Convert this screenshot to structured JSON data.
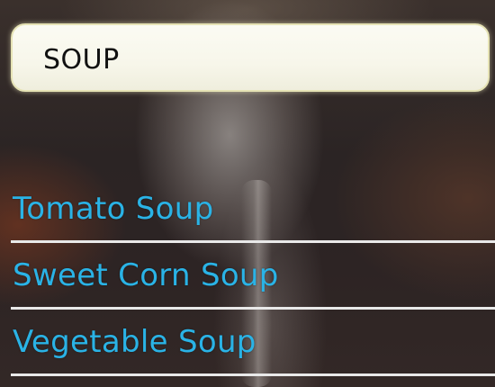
{
  "search": {
    "value": "SOUP",
    "placeholder": ""
  },
  "results": [
    {
      "label": "Tomato Soup"
    },
    {
      "label": "Sweet Corn Soup"
    },
    {
      "label": "Vegetable Soup"
    }
  ],
  "colors": {
    "result_text": "#2ab3e6",
    "divider": "#e9e9e9",
    "search_border": "#e6e3b5",
    "search_background": "#f7f6ea"
  }
}
